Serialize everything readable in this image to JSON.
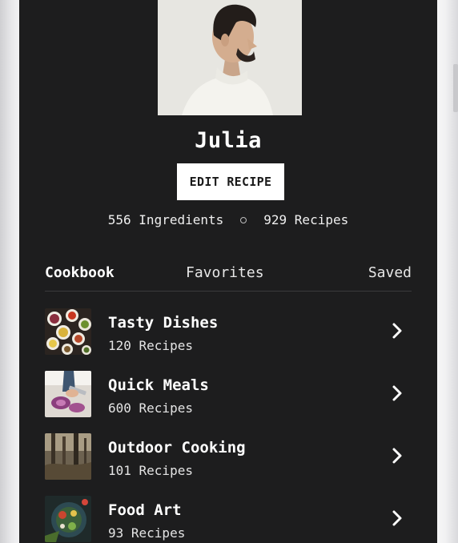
{
  "profile": {
    "name": "Julia",
    "edit_label": "EDIT RECIPE",
    "ingredients_stat": "556 Ingredients",
    "recipes_stat": "929 Recipes"
  },
  "tabs": [
    {
      "label": "Cookbook",
      "active": true
    },
    {
      "label": "Favorites",
      "active": false
    },
    {
      "label": "Saved",
      "active": false
    }
  ],
  "collections": [
    {
      "title": "Tasty Dishes",
      "subtitle": "120 Recipes",
      "thumb_icon": "spice-bowls-photo"
    },
    {
      "title": "Quick Meals",
      "subtitle": "600 Recipes",
      "thumb_icon": "cutting-onion-photo"
    },
    {
      "title": "Outdoor Cooking",
      "subtitle": "101 Recipes",
      "thumb_icon": "forest-photo"
    },
    {
      "title": "Food Art",
      "subtitle": "93 Recipes",
      "thumb_icon": "plated-food-photo"
    }
  ],
  "colors": {
    "screen_background": "#1d1d1e",
    "text": "#ffffff",
    "button_background": "#ffffff",
    "button_text": "#1a1a1a"
  }
}
